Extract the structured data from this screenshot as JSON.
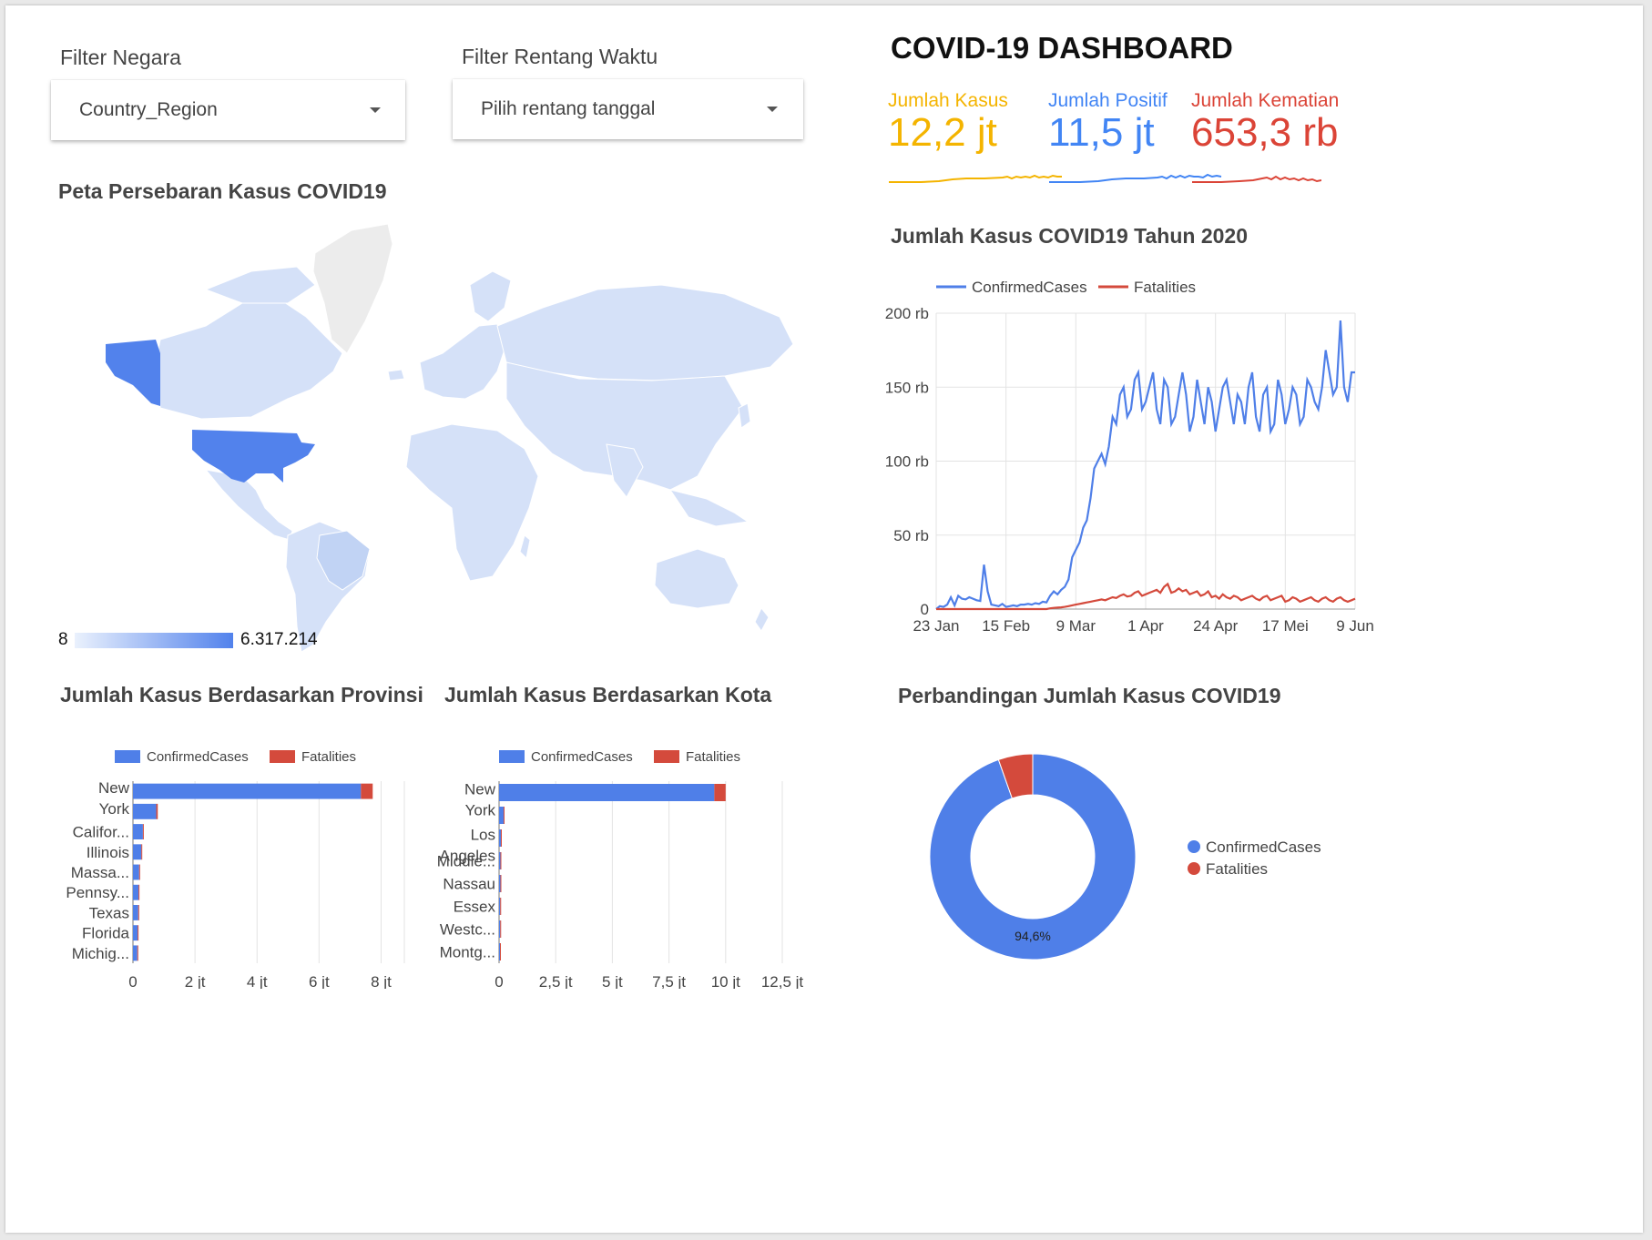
{
  "filters": {
    "country": {
      "label": "Filter Negara",
      "value": "Country_Region"
    },
    "date": {
      "label": "Filter Rentang Waktu",
      "value": "Pilih rentang tanggal"
    }
  },
  "dashboard_title": "COVID-19 DASHBOARD",
  "kpis": [
    {
      "label": "Jumlah Kasus",
      "value": "12,2 jt",
      "color": "#f4b400"
    },
    {
      "label": "Jumlah Positif",
      "value": "11,5 jt",
      "color": "#4285f4"
    },
    {
      "label": "Jumlah Kematian",
      "value": "653,3 rb",
      "color": "#db4437"
    }
  ],
  "map": {
    "title": "Peta Persebaran Kasus COVID19",
    "scale_min": "8",
    "scale_max": "6.317.214",
    "color_low": "#dbe6fb",
    "color_high": "#5282ec"
  },
  "colors": {
    "confirmed": "#4f7fe8",
    "fatalities": "#d44a3c"
  },
  "chart_data": [
    {
      "type": "line",
      "title": "Jumlah Kasus COVID19 Tahun 2020",
      "series": [
        {
          "name": "ConfirmedCases",
          "values": [
            0,
            2000,
            1500,
            3000,
            8000,
            2500,
            9000,
            7000,
            6500,
            8000,
            7000,
            6000,
            5500,
            30000,
            12000,
            3000,
            2500,
            2000,
            3500,
            1500,
            2000,
            2500,
            2000,
            3000,
            3000,
            3500,
            3000,
            4000,
            3500,
            5000,
            4500,
            9000,
            12000,
            10000,
            13000,
            15000,
            20000,
            35000,
            40000,
            45000,
            55000,
            60000,
            75000,
            95000,
            100000,
            105000,
            98000,
            110000,
            130000,
            125000,
            145000,
            150000,
            130000,
            135000,
            155000,
            160000,
            135000,
            140000,
            150000,
            160000,
            135000,
            125000,
            155000,
            150000,
            125000,
            130000,
            145000,
            160000,
            145000,
            120000,
            130000,
            155000,
            140000,
            125000,
            150000,
            140000,
            120000,
            135000,
            150000,
            155000,
            140000,
            125000,
            145000,
            140000,
            125000,
            150000,
            160000,
            130000,
            120000,
            145000,
            150000,
            120000,
            125000,
            155000,
            145000,
            125000,
            135000,
            150000,
            145000,
            125000,
            130000,
            155000,
            150000,
            140000,
            135000,
            150000,
            175000,
            160000,
            145000,
            150000,
            195000,
            150000,
            140000,
            160000,
            160000
          ]
        },
        {
          "name": "Fatalities",
          "values": [
            0,
            0,
            0,
            0,
            0,
            0,
            0,
            0,
            0,
            0,
            0,
            0,
            0,
            0,
            0,
            0,
            0,
            0,
            0,
            0,
            0,
            0,
            0,
            0,
            0,
            0,
            0,
            0,
            0,
            0,
            0,
            500,
            800,
            1000,
            1200,
            1500,
            2000,
            2500,
            3000,
            3500,
            4000,
            4500,
            5000,
            5500,
            6000,
            6500,
            6000,
            7000,
            8000,
            7500,
            9000,
            10000,
            8500,
            9000,
            11000,
            12000,
            9000,
            10000,
            11000,
            12000,
            13000,
            11000,
            15000,
            17000,
            11000,
            12000,
            14000,
            12000,
            13000,
            10000,
            11000,
            12000,
            9000,
            10000,
            12000,
            8000,
            9000,
            7000,
            10000,
            8000,
            7000,
            9000,
            8000,
            6000,
            7000,
            8000,
            9000,
            7000,
            6000,
            8000,
            9000,
            6000,
            7000,
            8000,
            9000,
            5000,
            6000,
            8000,
            7000,
            5000,
            6000,
            7000,
            8000,
            6000,
            5000,
            7000,
            8000,
            6000,
            5000,
            7000,
            8000,
            6000,
            5000,
            6000,
            7000
          ]
        }
      ],
      "x_tick_labels": [
        "23 Jan",
        "15 Feb",
        "9 Mar",
        "1 Apr",
        "24 Apr",
        "17 Mei",
        "9 Jun"
      ],
      "y_tick_labels": [
        "0",
        "50 rb",
        "100 rb",
        "150 rb",
        "200 rb"
      ],
      "ylim": [
        0,
        200000
      ],
      "legend": "top",
      "grid": true
    },
    {
      "type": "bar",
      "orientation": "horizontal",
      "stacked": true,
      "title": "Jumlah Kasus Berdasarkan Provinsi",
      "categories": [
        "New York",
        "",
        "California",
        "Illinois",
        "Massachusetts",
        "Pennsylvania",
        "Texas",
        "Florida",
        "Michigan"
      ],
      "category_labels": [
        [
          "New",
          "York"
        ],
        [
          ""
        ],
        [
          "Califor..."
        ],
        [
          "Illinois"
        ],
        [
          "Massa..."
        ],
        [
          "Pennsy..."
        ],
        [
          "Texas"
        ],
        [
          "Florida"
        ],
        [
          "Michig..."
        ]
      ],
      "series": [
        {
          "name": "ConfirmedCases",
          "values": [
            7350000,
            750000,
            320000,
            270000,
            200000,
            180000,
            170000,
            150000,
            140000
          ]
        },
        {
          "name": "Fatalities",
          "values": [
            380000,
            50000,
            12000,
            12000,
            12000,
            10000,
            5000,
            6000,
            12000
          ]
        }
      ],
      "x_tick_labels": [
        "0",
        "2 jt",
        "4 jt",
        "6 jt",
        "8 jt"
      ],
      "xlim": [
        0,
        8750000
      ],
      "legend": "top",
      "grid": true
    },
    {
      "type": "bar",
      "orientation": "horizontal",
      "stacked": true,
      "title": "Jumlah Kasus Berdasarkan Kota",
      "categories": [
        "New York",
        "",
        "Los Angeles",
        "Middlesex",
        "Nassau",
        "Essex",
        "Westchester",
        "Montgomery"
      ],
      "category_labels": [
        [
          "New",
          "York"
        ],
        [
          ""
        ],
        [
          "Los",
          "Angeles"
        ],
        [
          "Middle..."
        ],
        [
          "Nassau"
        ],
        [
          "Essex"
        ],
        [
          "Westc..."
        ],
        [
          "Montg..."
        ]
      ],
      "series": [
        {
          "name": "ConfirmedCases",
          "values": [
            9500000,
            200000,
            80000,
            60000,
            60000,
            50000,
            50000,
            40000
          ]
        },
        {
          "name": "Fatalities",
          "values": [
            500000,
            10000,
            4000,
            4000,
            4000,
            4000,
            3000,
            2000
          ]
        }
      ],
      "x_tick_labels": [
        "0",
        "2,5 jt",
        "5 jt",
        "7,5 jt",
        "10 jt",
        "12,5 jt"
      ],
      "xlim": [
        0,
        12500000
      ],
      "legend": "top",
      "grid": true
    },
    {
      "type": "pie",
      "donut": true,
      "title": "Perbandingan Jumlah Kasus COVID19",
      "series": [
        {
          "name": "ConfirmedCases",
          "value": 94.6
        },
        {
          "name": "Fatalities",
          "value": 5.4
        }
      ],
      "slice_label": "94,6%",
      "legend": "right"
    }
  ]
}
